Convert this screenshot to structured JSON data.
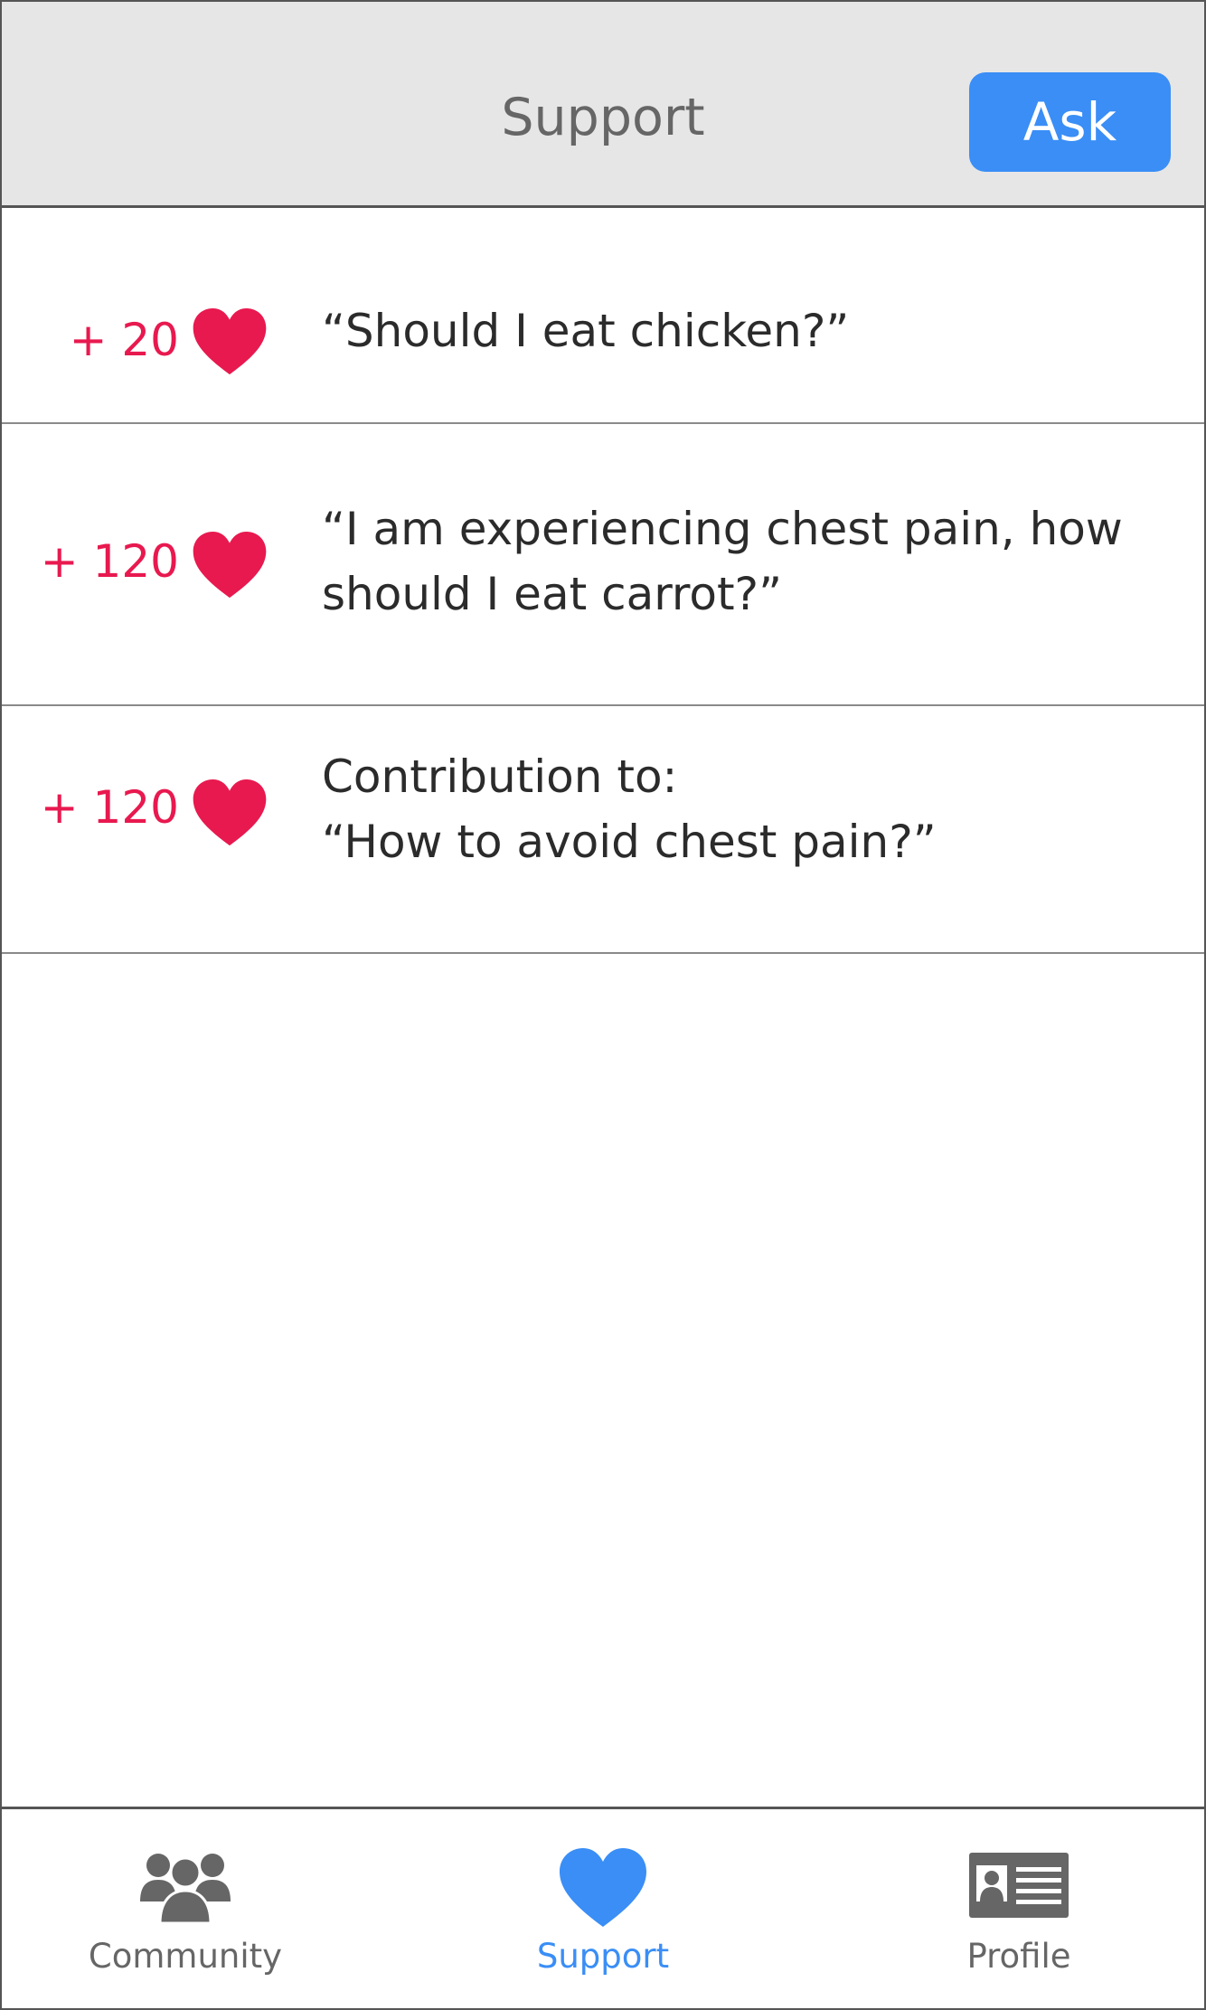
{
  "header": {
    "title": "Support",
    "ask_label": "Ask"
  },
  "colors": {
    "accent": "#3a8ef6",
    "heart": "#e8194f",
    "header_bg": "#e6e6e6",
    "inactive": "#666666"
  },
  "feed": {
    "items": [
      {
        "points": "+ 20",
        "lines": [
          "“Should I eat chicken?”"
        ]
      },
      {
        "points": "+ 120",
        "lines": [
          "“I am experiencing chest pain, how",
          "should I eat carrot?”"
        ]
      },
      {
        "points": "+ 120",
        "lines": [
          "Contribution to:",
          "“How to avoid chest pain?”"
        ]
      }
    ]
  },
  "tabbar": {
    "tabs": [
      {
        "label": "Community",
        "icon": "community-icon",
        "active": false
      },
      {
        "label": "Support",
        "icon": "heart-icon",
        "active": true
      },
      {
        "label": "Profile",
        "icon": "profile-card-icon",
        "active": false
      }
    ]
  }
}
